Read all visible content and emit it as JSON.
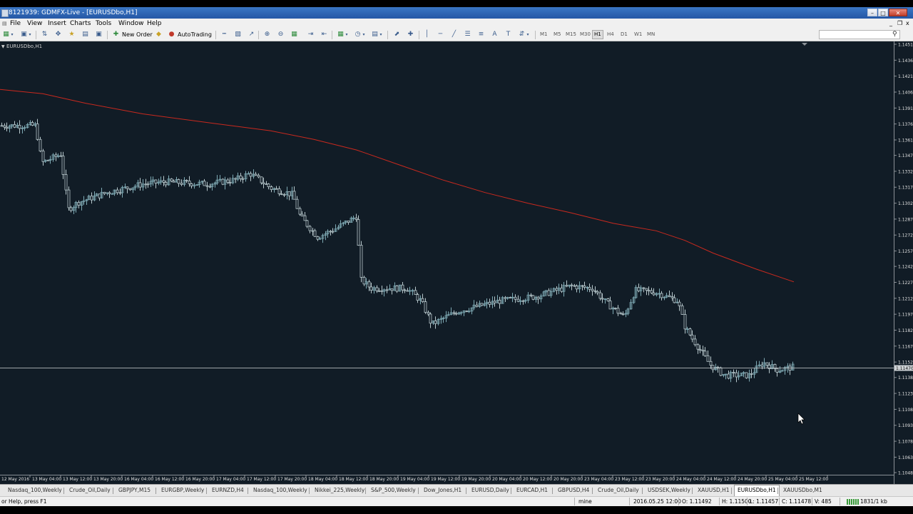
{
  "window": {
    "title": "8121939: GDMFX-Live - [EURUSDbo,H1]",
    "minimize_label": "–",
    "maximize_label": "□",
    "close_label": "✕",
    "mdi_min_label": "_",
    "mdi_restore_label": "❐",
    "mdi_close_label": "x"
  },
  "menu": [
    "File",
    "View",
    "Insert",
    "Charts",
    "Tools",
    "Window",
    "Help"
  ],
  "toolbar": {
    "new_order_label": "New Order",
    "autotrading_label": "AutoTrading",
    "timeframes": [
      "M1",
      "M5",
      "M15",
      "M30",
      "H1",
      "H4",
      "D1",
      "W1",
      "MN"
    ],
    "active_timeframe": "H1",
    "icons": [
      "new-chart-icon",
      "profiles-icon",
      "market-watch-icon",
      "navigator-icon",
      "data-window-icon",
      "terminal-icon",
      "strategy-tester-icon",
      "metaeditor-icon",
      "bar-chart-icon",
      "candlesticks-icon",
      "line-chart-icon",
      "zoom-in-icon",
      "zoom-out-icon",
      "tile-windows-icon",
      "autoscroll-icon",
      "chart-shift-icon",
      "indicators-icon",
      "periods-icon",
      "templates-icon",
      "cursor-icon",
      "crosshair-icon",
      "vertical-line-icon",
      "horizontal-line-icon",
      "trendline-icon",
      "equidistant-channel-icon",
      "fibonacci-icon",
      "text-icon",
      "text-label-icon",
      "arrows-icon",
      "search-icon"
    ]
  },
  "chart": {
    "label": "EURUSDbo,H1",
    "symbol": "EURUSDbo",
    "timeframe": "H1",
    "current_price_label": "1.11470",
    "colors": {
      "background": "#111c26",
      "candle": "#7ea9b3",
      "bear_tint": "#b8c8cc",
      "ma_line": "#c9291e",
      "bid_line": "#cfd3d6",
      "axis_text": "#e0e0e0"
    },
    "price_ticks": [
      "1.14515",
      "1.14365",
      "1.14215",
      "1.14065",
      "1.13915",
      "1.13765",
      "1.13615",
      "1.13470",
      "1.13320",
      "1.13170",
      "1.13020",
      "1.12870",
      "1.12720",
      "1.12570",
      "1.12425",
      "1.12275",
      "1.12125",
      "1.11975",
      "1.11825",
      "1.11675",
      "1.11525",
      "1.11380",
      "1.11230",
      "1.11080",
      "1.10930",
      "1.10780",
      "1.10630",
      "1.10485"
    ],
    "time_ticks": [
      "12 May 2016",
      "13 May 04:00",
      "13 May 12:00",
      "13 May 20:00",
      "16 May 04:00",
      "16 May 12:00",
      "16 May 20:00",
      "17 May 04:00",
      "17 May 12:00",
      "17 May 20:00",
      "18 May 04:00",
      "18 May 12:00",
      "18 May 20:00",
      "19 May 04:00",
      "19 May 12:00",
      "19 May 20:00",
      "20 May 04:00",
      "20 May 12:00",
      "20 May 20:00",
      "23 May 04:00",
      "23 May 12:00",
      "23 May 20:00",
      "24 May 04:00",
      "24 May 12:00",
      "24 May 20:00",
      "25 May 04:00",
      "25 May 12:00"
    ]
  },
  "tabs": [
    "Nasdaq_100,Weekly",
    "Crude_Oil,Daily",
    "GBPJPY,M15",
    "EURGBP,Weekly",
    "EURNZD,H4",
    "Nasdaq_100,Weekly",
    "Nikkei_225,Weekly",
    "S&P_500,Weekly",
    "Dow_Jones,H1",
    "EURUSD,Daily",
    "EURCAD,H1",
    "GBPUSD,H4",
    "Crude_Oil,Daily",
    "USDSEK,Weekly",
    "XAUUSD,H1",
    "EURUSDbo,H1",
    "XAUUSDbo,M1"
  ],
  "active_tab": "EURUSDbo,H1",
  "status": {
    "help": "or Help, press F1",
    "profile": "mine",
    "datetime": "2016.05.25 12:00",
    "open": "O: 1.11492",
    "high": "H: 1.11500",
    "low": "L: 1.11457",
    "close": "C: 1.11478",
    "volume": "V: 485",
    "traffic": "1831/1 kb"
  }
}
